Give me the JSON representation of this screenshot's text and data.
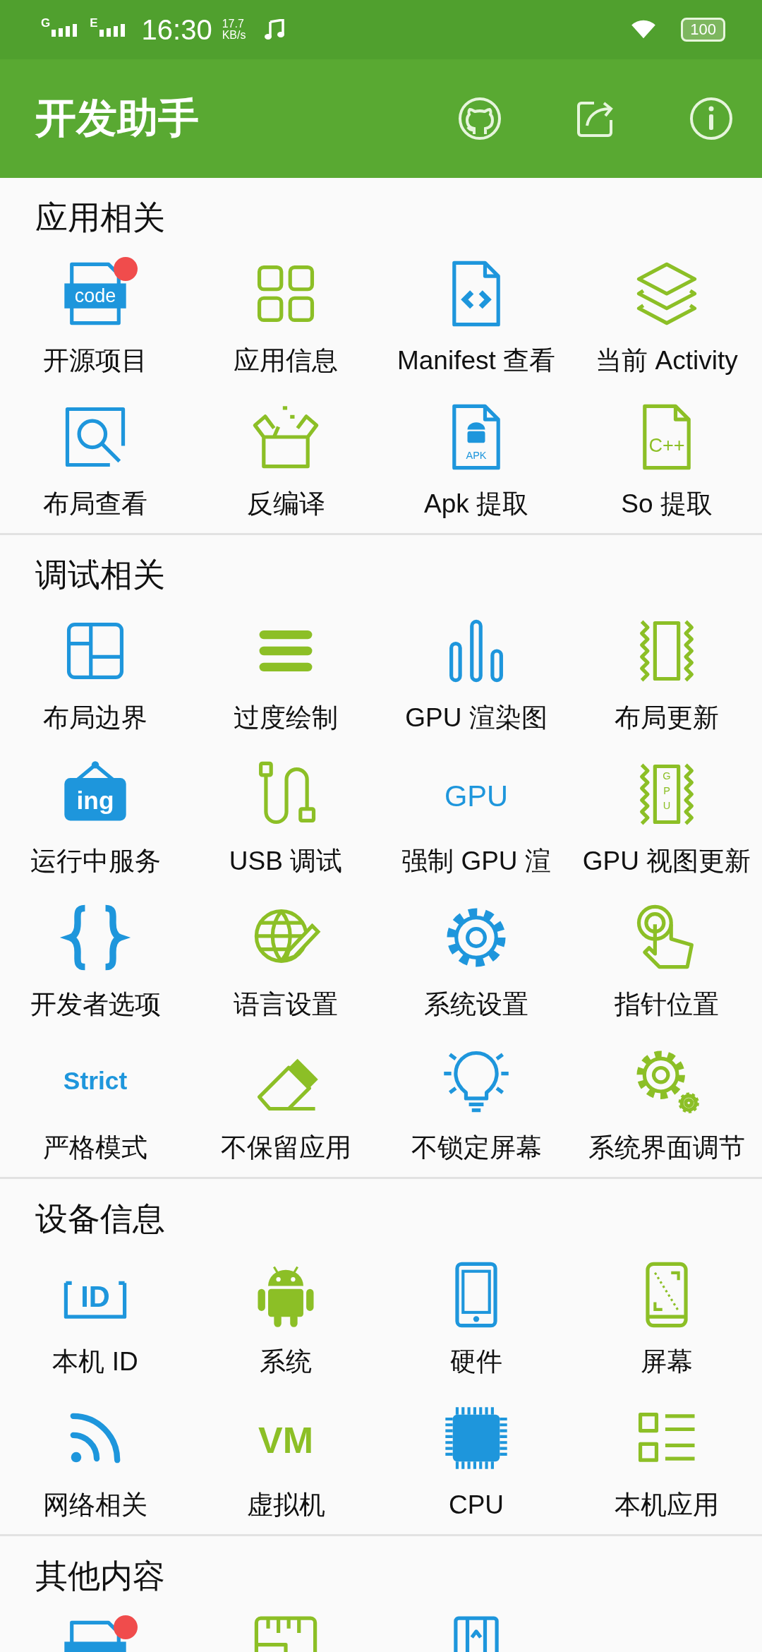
{
  "status_bar": {
    "sim1": "G",
    "sim2": "E",
    "time": "16:30",
    "speed": "17.7",
    "speed_unit": "KB/s",
    "battery": "100"
  },
  "app_bar": {
    "title": "开发助手"
  },
  "sections": [
    {
      "title": "应用相关",
      "items": [
        {
          "label": "开源项目",
          "color": "#1e96dc",
          "icon_text": "code",
          "badge": true
        },
        {
          "label": "应用信息",
          "color": "#8cbf26",
          "badge": false
        },
        {
          "label": "Manifest 查看",
          "color": "#1e96dc",
          "badge": false
        },
        {
          "label": "当前 Activity",
          "color": "#8cbf26",
          "badge": false
        },
        {
          "label": "布局查看",
          "color": "#1e96dc",
          "badge": false
        },
        {
          "label": "反编译",
          "color": "#8cbf26",
          "badge": false
        },
        {
          "label": "Apk 提取",
          "color": "#1e96dc",
          "icon_text": "APK",
          "badge": false
        },
        {
          "label": "So 提取",
          "color": "#8cbf26",
          "icon_text": "C++",
          "badge": false
        }
      ]
    },
    {
      "title": "调试相关",
      "items": [
        {
          "label": "布局边界",
          "color": "#1e96dc",
          "badge": false
        },
        {
          "label": "过度绘制",
          "color": "#8cbf26",
          "badge": false
        },
        {
          "label": "GPU 渲染图",
          "color": "#1e96dc",
          "badge": false
        },
        {
          "label": "布局更新",
          "color": "#8cbf26",
          "badge": false
        },
        {
          "label": "运行中服务",
          "color": "#1e96dc",
          "icon_text": "ing",
          "badge": false
        },
        {
          "label": "USB 调试",
          "color": "#8cbf26",
          "badge": false
        },
        {
          "label": "强制 GPU 渲",
          "color": "#1e96dc",
          "icon_text": "GPU",
          "badge": false
        },
        {
          "label": "GPU 视图更新",
          "color": "#8cbf26",
          "icon_text": "GPU",
          "badge": false
        },
        {
          "label": "开发者选项",
          "color": "#1e96dc",
          "badge": false
        },
        {
          "label": "语言设置",
          "color": "#8cbf26",
          "badge": false
        },
        {
          "label": "系统设置",
          "color": "#1e96dc",
          "badge": false
        },
        {
          "label": "指针位置",
          "color": "#8cbf26",
          "badge": false
        },
        {
          "label": "严格模式",
          "color": "#1e96dc",
          "icon_text": "Strict",
          "badge": false
        },
        {
          "label": "不保留应用",
          "color": "#8cbf26",
          "badge": false
        },
        {
          "label": "不锁定屏幕",
          "color": "#1e96dc",
          "badge": false
        },
        {
          "label": "系统界面调节",
          "color": "#8cbf26",
          "badge": false
        }
      ]
    },
    {
      "title": "设备信息",
      "items": [
        {
          "label": "本机 ID",
          "color": "#1e96dc",
          "icon_text": "ID",
          "badge": false
        },
        {
          "label": "系统",
          "color": "#8cbf26",
          "badge": false
        },
        {
          "label": "硬件",
          "color": "#1e96dc",
          "badge": false
        },
        {
          "label": "屏幕",
          "color": "#8cbf26",
          "badge": false
        },
        {
          "label": "网络相关",
          "color": "#1e96dc",
          "badge": false
        },
        {
          "label": "虚拟机",
          "color": "#8cbf26",
          "icon_text": "VM",
          "badge": false
        },
        {
          "label": "CPU",
          "color": "#1e96dc",
          "badge": false
        },
        {
          "label": "本机应用",
          "color": "#8cbf26",
          "badge": false
        }
      ]
    },
    {
      "title": "其他内容",
      "items": [
        {
          "color": "#1e96dc",
          "badge": true
        },
        {
          "color": "#8cbf26",
          "badge": false
        },
        {
          "color": "#1e96dc",
          "badge": false
        }
      ]
    }
  ]
}
